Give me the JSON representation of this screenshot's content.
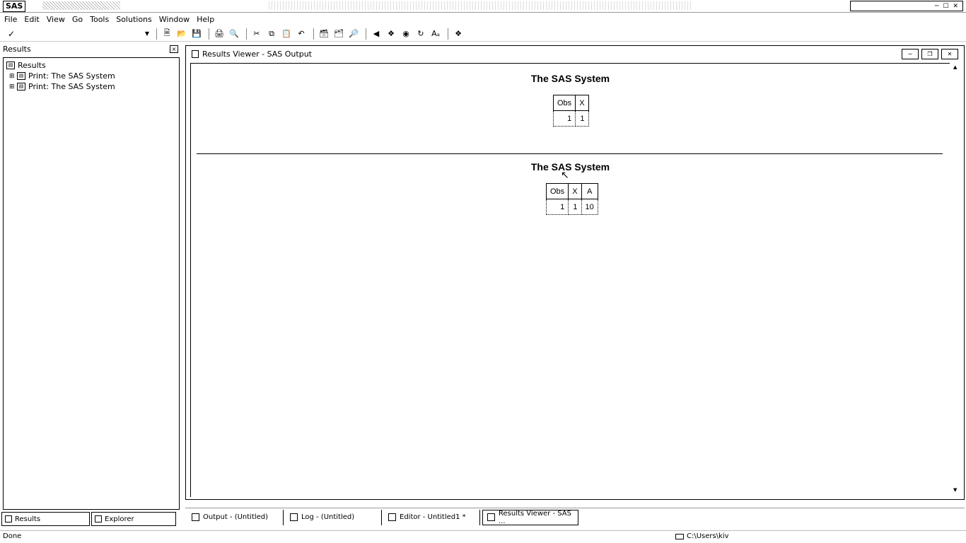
{
  "app": {
    "logo": "SAS"
  },
  "menu": [
    "File",
    "Edit",
    "View",
    "Go",
    "Tools",
    "Solutions",
    "Window",
    "Help"
  ],
  "toolbar": {
    "icons": [
      "new-icon",
      "open-icon",
      "save-icon",
      "print-icon",
      "print-preview-icon",
      "cut-icon",
      "copy-icon",
      "paste-icon",
      "undo-icon",
      "new-library-icon",
      "sas-explorer-icon",
      "query-icon",
      "back-icon",
      "forward-icon",
      "stop-icon",
      "refresh-icon",
      "font-icon",
      "help-icon"
    ]
  },
  "left_pane": {
    "header": "Results",
    "tree": {
      "root": "Results",
      "items": [
        "Print:  The SAS System",
        "Print:  The SAS System"
      ]
    },
    "tabs": [
      "Results",
      "Explorer"
    ]
  },
  "viewer": {
    "title": "Results Viewer - SAS Output",
    "outputs": [
      {
        "title": "The SAS System",
        "columns": [
          "Obs",
          "X"
        ],
        "rows": [
          [
            "1",
            "1"
          ]
        ]
      },
      {
        "title": "The SAS System",
        "columns": [
          "Obs",
          "X",
          "A"
        ],
        "rows": [
          [
            "1",
            "1",
            "10"
          ]
        ]
      }
    ]
  },
  "window_tabs": [
    "Output - (Untitled)",
    "Log - (Untitled)",
    "Editor - Untitled1 *",
    "Results Viewer - SAS ..."
  ],
  "status": {
    "text": "Done",
    "path": "C:\\Users\\kiv"
  }
}
